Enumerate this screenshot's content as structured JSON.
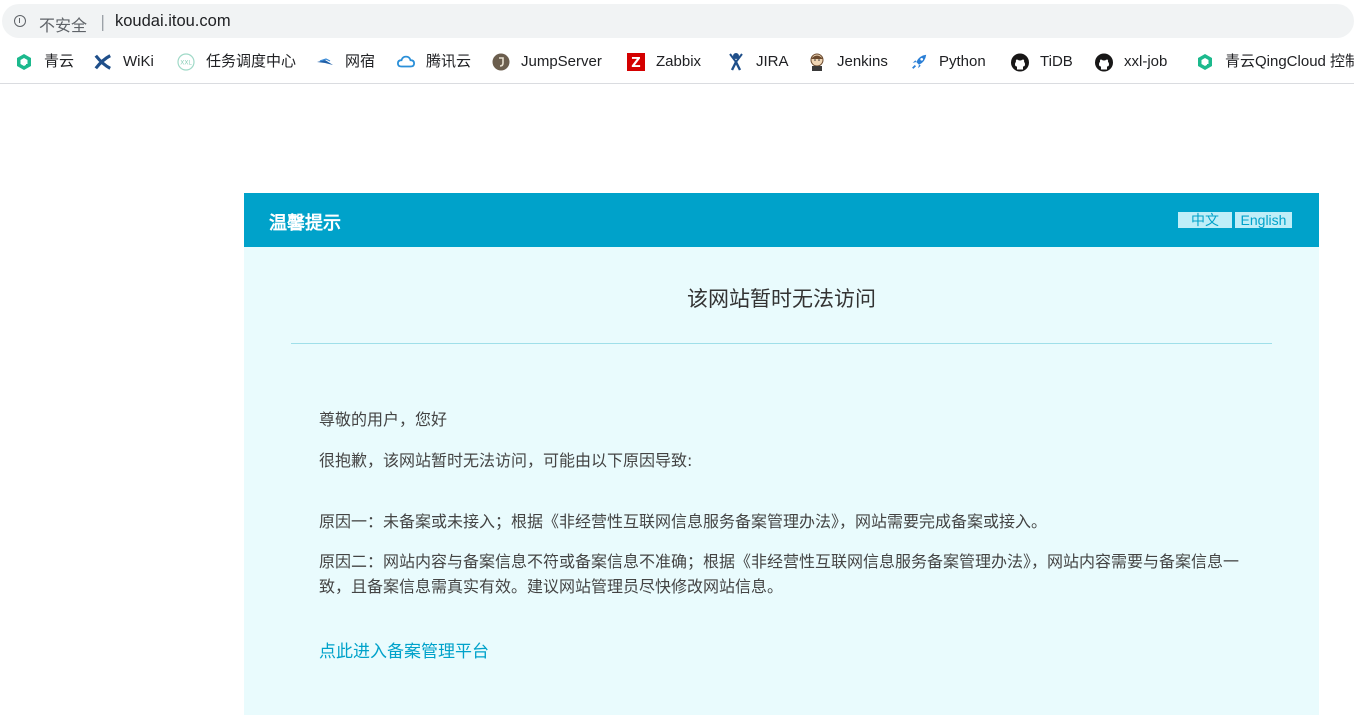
{
  "addressbar": {
    "security_label": "不安全",
    "separator": "|",
    "url": "koudai.itou.com"
  },
  "bookmarks": [
    {
      "label": "青云",
      "icon": "qingcloud-icon"
    },
    {
      "label": "WiKi",
      "icon": "confluence-icon"
    },
    {
      "label": "任务调度中心",
      "icon": "xxl-icon"
    },
    {
      "label": "网宿",
      "icon": "wangsu-icon"
    },
    {
      "label": "腾讯云",
      "icon": "tencent-cloud-icon"
    },
    {
      "label": "JumpServer",
      "icon": "jumpserver-icon"
    },
    {
      "label": "Zabbix",
      "icon": "zabbix-icon"
    },
    {
      "label": "JIRA",
      "icon": "jira-icon"
    },
    {
      "label": "Jenkins",
      "icon": "jenkins-icon"
    },
    {
      "label": "Python",
      "icon": "rocket-icon"
    },
    {
      "label": "TiDB",
      "icon": "github-icon"
    },
    {
      "label": "xxl-job",
      "icon": "github-icon"
    },
    {
      "label": "青云QingCloud 控制",
      "icon": "qingcloud-icon"
    }
  ],
  "card": {
    "title": "温馨提示",
    "lang_zh": "中文",
    "lang_en": "English",
    "headline": "该网站暂时无法访问",
    "greeting": "尊敬的用户，您好",
    "apology": "很抱歉，该网站暂时无法访问，可能由以下原因导致:",
    "reason1": "原因一：未备案或未接入；根据《非经营性互联网信息服务备案管理办法》，网站需要完成备案或接入。",
    "reason2": "原因二：网站内容与备案信息不符或备案信息不准确；根据《非经营性互联网信息服务备案管理办法》，网站内容需要与备案信息一致，且备案信息需真实有效。建议网站管理员尽快修改网站信息。",
    "link": "点此进入备案管理平台"
  },
  "colors": {
    "header": "#00a2ca",
    "card_bg": "#e9fbfd",
    "link": "#00a2ca"
  }
}
